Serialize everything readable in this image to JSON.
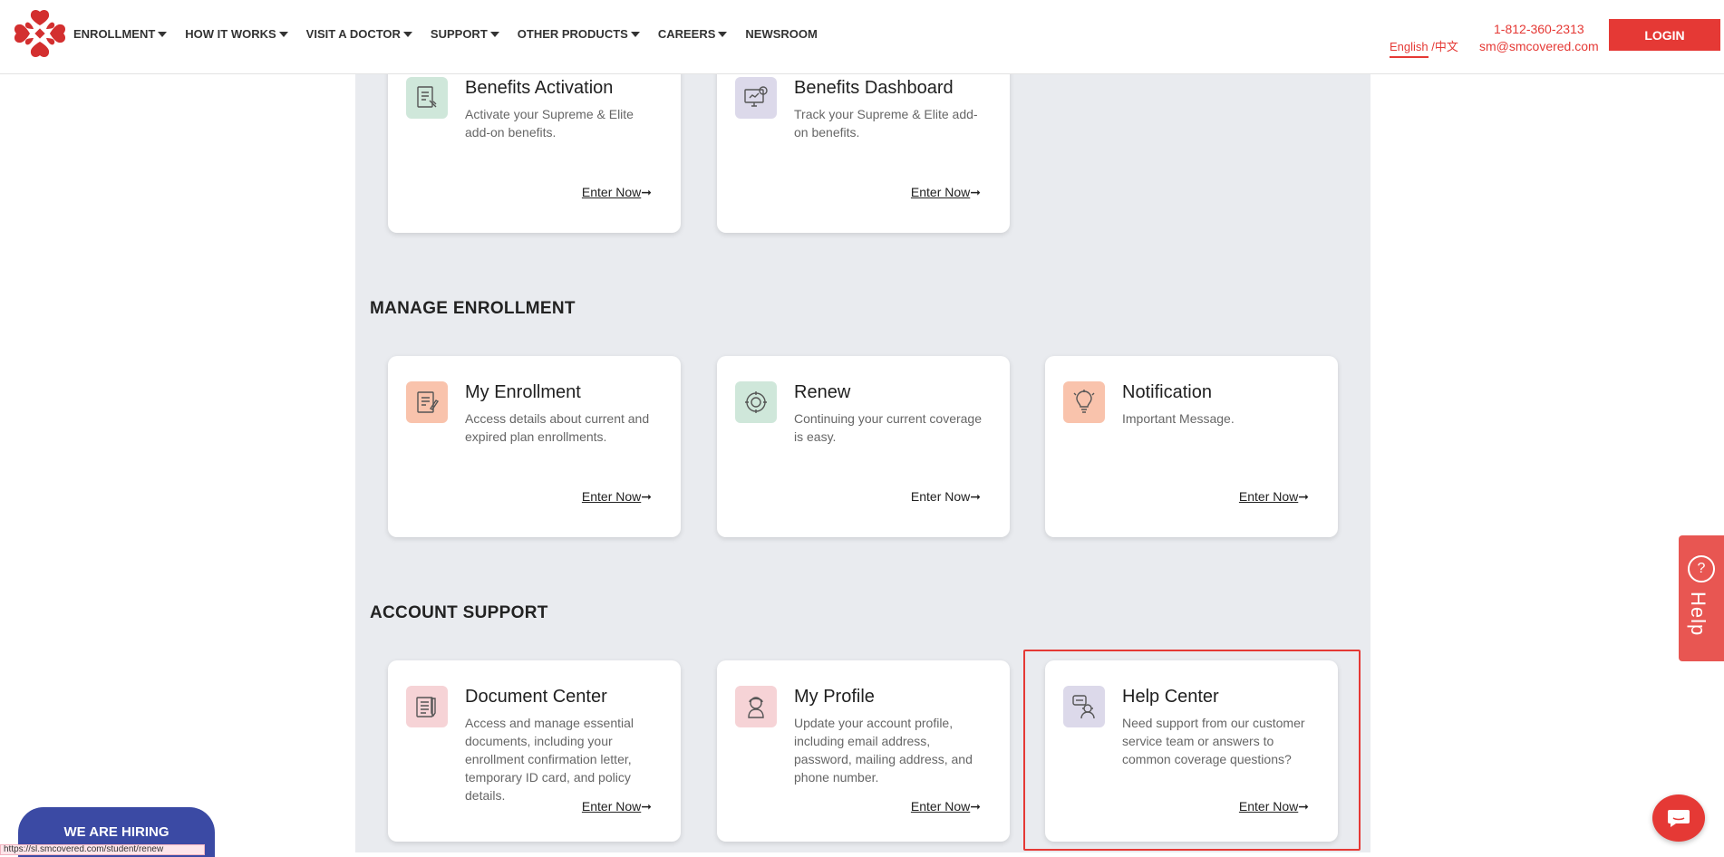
{
  "header": {
    "nav": [
      {
        "label": "ENROLLMENT",
        "has_caret": true
      },
      {
        "label": "HOW IT WORKS",
        "has_caret": true
      },
      {
        "label": "VISIT A DOCTOR",
        "has_caret": true
      },
      {
        "label": "SUPPORT",
        "has_caret": true
      },
      {
        "label": "OTHER PRODUCTS",
        "has_caret": true
      },
      {
        "label": "CAREERS",
        "has_caret": true
      },
      {
        "label": "NEWSROOM",
        "has_caret": false
      }
    ],
    "lang_english": "English",
    "lang_sep": "/",
    "lang_chinese": "中文",
    "phone": "1-812-360-2313",
    "email": "sm@smcovered.com",
    "login_label": "LOGIN",
    "brand_color": "#e53935"
  },
  "top_cards": [
    {
      "title": "Benefits Activation",
      "desc": "Activate your Supreme & Elite add-on benefits.",
      "enter": "Enter Now",
      "icon": "benefits-activation-icon",
      "icon_bg": "#cfe7da"
    },
    {
      "title": "Benefits Dashboard",
      "desc": "Track your Supreme & Elite add-on benefits.",
      "enter": "Enter Now",
      "icon": "benefits-dashboard-icon",
      "icon_bg": "#dcd9ea"
    }
  ],
  "manage": {
    "title": "MANAGE ENROLLMENT",
    "cards": [
      {
        "title": "My Enrollment",
        "desc": "Access details about current and expired plan enrollments.",
        "enter": "Enter Now",
        "icon": "enrollment-document-icon",
        "icon_bg": "#f9c3ac"
      },
      {
        "title": "Renew",
        "desc": "Continuing your current coverage is easy.",
        "enter": "Enter Now",
        "icon": "renew-icon",
        "icon_bg": "#cfe7da"
      },
      {
        "title": "Notification",
        "desc": "Important Message.",
        "enter": "Enter Now",
        "icon": "lightbulb-icon",
        "icon_bg": "#f9c3ac"
      }
    ]
  },
  "support": {
    "title": "ACCOUNT SUPPORT",
    "cards": [
      {
        "title": "Document Center",
        "desc": "Access and manage essential documents, including your enrollment confirmation letter, temporary ID card, and policy details.",
        "enter": "Enter Now",
        "icon": "document-center-icon",
        "icon_bg": "#f6d3d6"
      },
      {
        "title": "My Profile",
        "desc": "Update your account profile, including email address, password, mailing address, and phone number.",
        "enter": "Enter Now",
        "icon": "profile-icon",
        "icon_bg": "#f6d3d6"
      },
      {
        "title": "Help Center",
        "desc": "Need support from our customer service team or answers to common coverage questions?",
        "enter": "Enter Now",
        "icon": "help-center-icon",
        "icon_bg": "#dcd9ea"
      }
    ]
  },
  "widgets": {
    "help_tab": "Help",
    "hiring": "WE ARE HIRING",
    "status_url": "https://sl.smcovered.com/student/renew"
  }
}
